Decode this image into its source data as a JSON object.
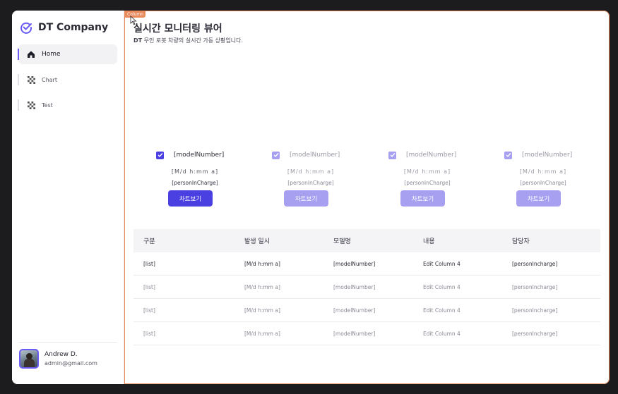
{
  "app": {
    "company": "DT Company",
    "accent": "#4a3fe0",
    "accent_faded": "#a79ff0",
    "highlight": "#e98a5c"
  },
  "sidebar": {
    "items": [
      {
        "label": "Home",
        "icon": "home-icon",
        "active": true
      },
      {
        "label": "Chart",
        "icon": "chart-icon",
        "active": false
      },
      {
        "label": "Test",
        "icon": "test-icon",
        "active": false
      }
    ]
  },
  "profile": {
    "name": "Andrew D.",
    "email": "admin@gmail.com"
  },
  "editor": {
    "column_tag": "Column"
  },
  "header": {
    "title": "실시간 모니터링 뷰어",
    "subtitle_prefix": "DT",
    "subtitle": " 무인 로봇 차량의 실시간 가동 상황입니다."
  },
  "cards": [
    {
      "model": "[modelNumber]",
      "datetime": "[M/d h:mm a]",
      "person": "[personInCharge]",
      "button": "차트보기",
      "checked": true
    },
    {
      "model": "[modelNumber]",
      "datetime": "[M/d h:mm a]",
      "person": "[personInCharge]",
      "button": "차트보기",
      "checked": true
    },
    {
      "model": "[modelNumber]",
      "datetime": "[M/d h:mm a]",
      "person": "[personInCharge]",
      "button": "차트보기",
      "checked": true
    },
    {
      "model": "[modelNumber]",
      "datetime": "[M/d h:mm a]",
      "person": "[personInCharge]",
      "button": "차트보기",
      "checked": true
    }
  ],
  "table": {
    "headers": [
      "구분",
      "발생 일시",
      "모델명",
      "내용",
      "담당자"
    ],
    "rows": [
      [
        "[list]",
        "[M/d h:mm a]",
        "[modelNumber]",
        "Edit Column 4",
        "[personIncharge]"
      ],
      [
        "[list]",
        "[M/d h:mm a]",
        "[modelNumber]",
        "Edit Column 4",
        "[personIncharge]"
      ],
      [
        "[list]",
        "[M/d h:mm a]",
        "[modelNumber]",
        "Edit Column 4",
        "[personIncharge]"
      ],
      [
        "[list]",
        "[M/d h:mm a]",
        "[modelNumber]",
        "Edit Column 4",
        "[personIncharge]"
      ]
    ]
  }
}
